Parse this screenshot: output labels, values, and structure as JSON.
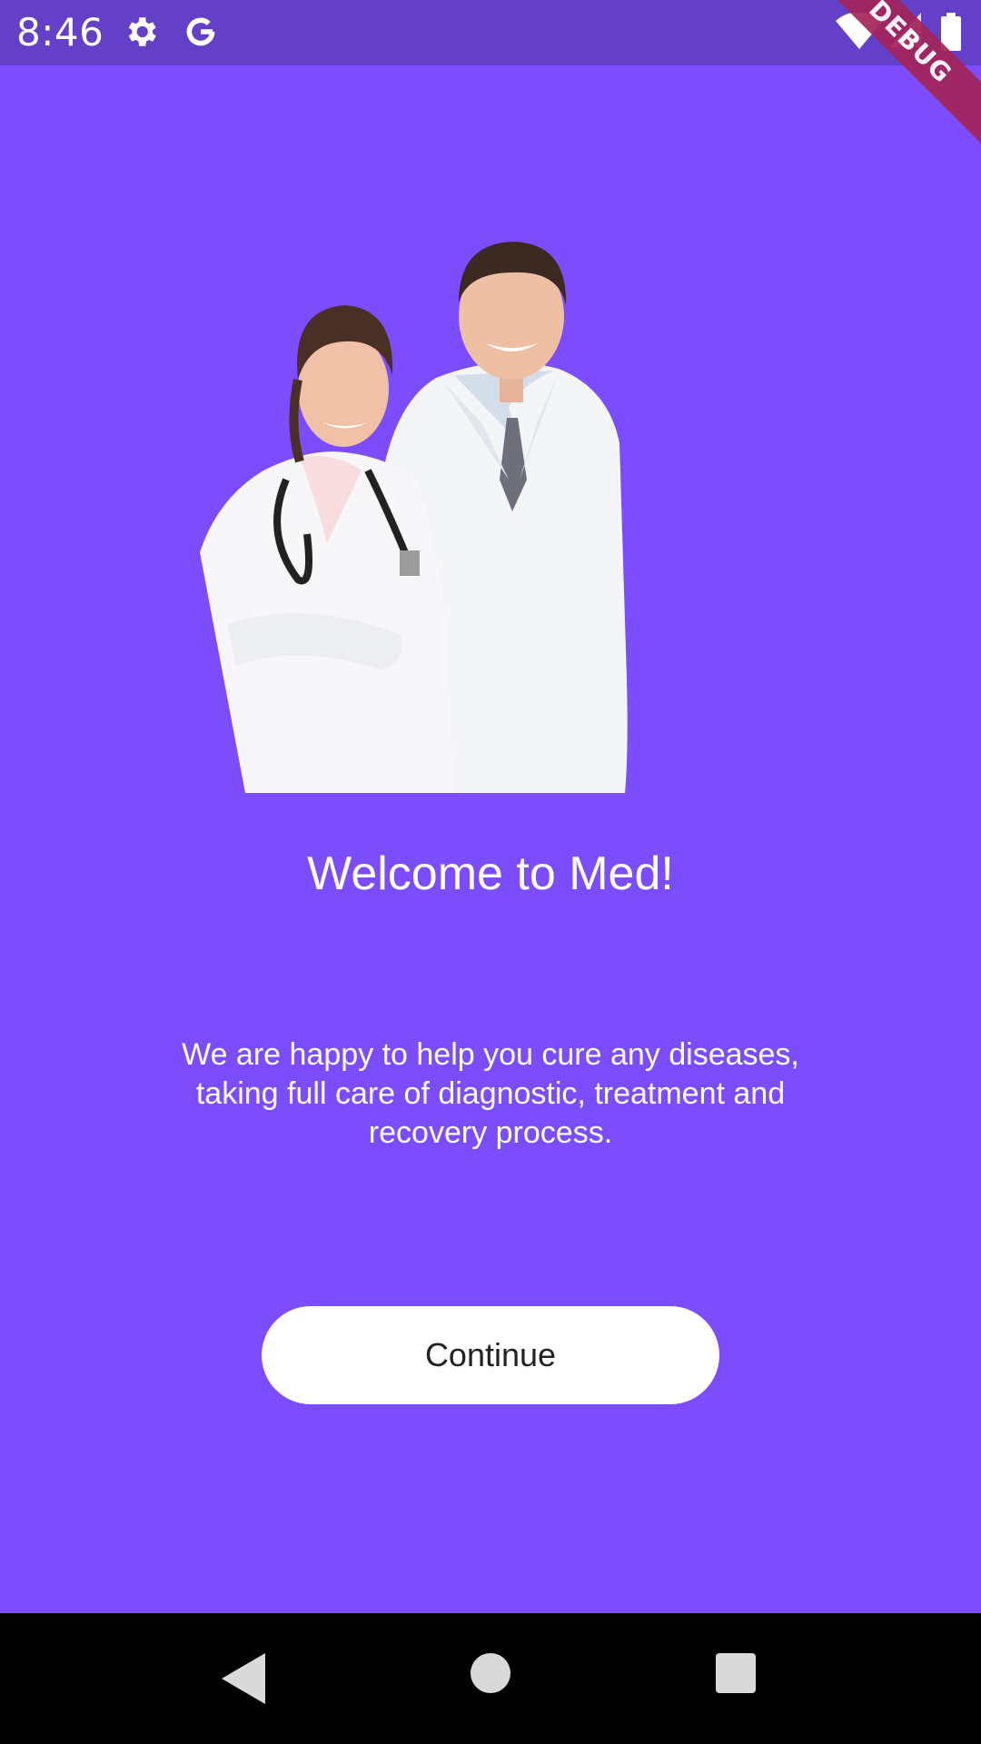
{
  "status_bar": {
    "time": "8:46",
    "icons": [
      "gear-icon",
      "google-icon",
      "wifi-icon",
      "signal-icon",
      "battery-icon"
    ]
  },
  "debug_banner": {
    "label": "DEBUG"
  },
  "hero": {
    "image": "two doctors in white coats"
  },
  "welcome": {
    "title": "Welcome to Med!",
    "description": "We are happy to help you cure any diseases, taking full care of diagnostic, treatment and recovery process."
  },
  "continue_button": {
    "label": "Continue"
  },
  "nav_bar": {
    "buttons": [
      "back",
      "home",
      "recents"
    ]
  },
  "colors": {
    "background": "#7c4dff",
    "status_bar": "#6440c8",
    "button": "#ffffff",
    "debug_banner": "#a3245a"
  }
}
